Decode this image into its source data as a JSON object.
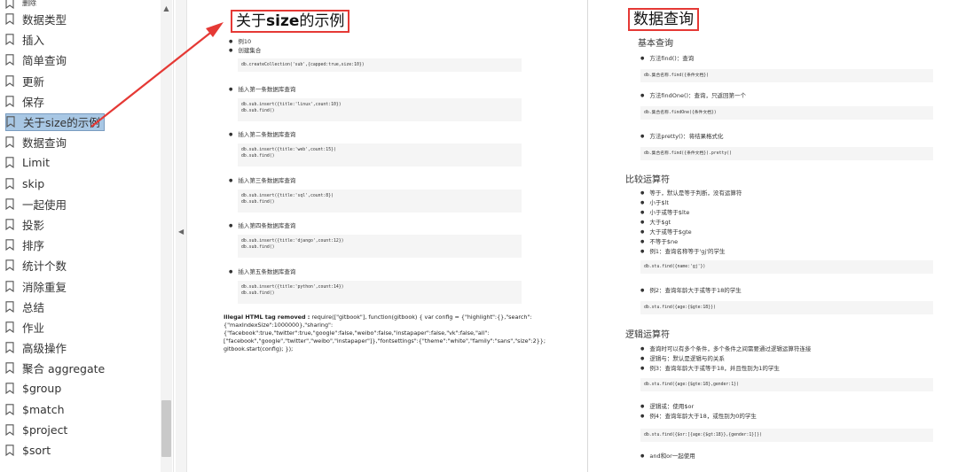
{
  "sidebar": {
    "items": [
      {
        "label": "删除"
      },
      {
        "label": "数据类型"
      },
      {
        "label": "插入"
      },
      {
        "label": "简单查询"
      },
      {
        "label": "更新"
      },
      {
        "label": "保存"
      },
      {
        "label": "关于size的示例"
      },
      {
        "label": "数据查询"
      },
      {
        "label": "Limit"
      },
      {
        "label": "skip"
      },
      {
        "label": "一起使用"
      },
      {
        "label": "投影"
      },
      {
        "label": "排序"
      },
      {
        "label": "统计个数"
      },
      {
        "label": "消除重复"
      },
      {
        "label": "总结"
      },
      {
        "label": "作业"
      },
      {
        "label": "高级操作"
      },
      {
        "label": "聚合 aggregate"
      },
      {
        "label": "$group"
      },
      {
        "label": "$match"
      },
      {
        "label": "$project"
      },
      {
        "label": "$sort"
      }
    ],
    "active_index": 6
  },
  "left_page": {
    "title_prefix": "关于",
    "title_bold": "size",
    "title_suffix": "的示例",
    "bullet1": "例10",
    "bullet2": "创建集合",
    "code1": "db.createCollection('sub',{capped:true,size:10})",
    "bullet3": "插入第一条数据库查询",
    "code2": "db.sub.insert({title:'linux',count:10})\ndb.sub.find()",
    "bullet4": "插入第二条数据库查询",
    "code3": "db.sub.insert({title:'web',count:15})\ndb.sub.find()",
    "bullet5": "插入第三条数据库查询",
    "code4": "db.sub.insert({title:'sql',count:8})\ndb.sub.find()",
    "bullet6": "插入第四条数据库查询",
    "code5": "db.sub.insert({title:'django',count:12})\ndb.sub.find()",
    "bullet7": "插入第五条数据库查询",
    "code6": "db.sub.insert({title:'python',count:14})\ndb.sub.find()",
    "para_bold": "Illegal HTML tag removed :",
    "para": " require([\"gitbook\"], function(gitbook) { var config = {\"highlight\":{},\"search\":\n{\"maxIndexSize\":1000000},\"sharing\":\n{\"facebook\":true,\"twitter\":true,\"google\":false,\"weibo\":false,\"instapaper\":false,\"vk\":false,\"all\":\n[\"facebook\",\"google\",\"twitter\",\"weibo\",\"instapaper\"]},\"fontsettings\":{\"theme\":\"white\",\"family\":\"sans\",\"size\":2}};\ngitbook.start(config); });"
  },
  "right_page": {
    "title": "数据查询",
    "h_basic": "基本查询",
    "b1": "方法find()：查询",
    "c1": "db.集合名称.find({条件文档})",
    "b2": "方法findOne()：查询，只返回第一个",
    "c2": "db.集合名称.findOne({条件文档})",
    "b3": "方法pretty()：将结果格式化",
    "c3": "db.集合名称.find({条件文档}).pretty()",
    "h_compare": "比较运算符",
    "cmp": [
      "等于，默认是等于判断，没有运算符",
      "小于$lt",
      "小于或等于$lte",
      "大于$gt",
      "大于或等于$gte",
      "不等于$ne",
      "例1：查询名称等于'gj'的学生"
    ],
    "c4": "db.stu.find({name:'gj'})",
    "b4": "例2：查询年龄大于或等于18的学生",
    "c5": "db.stu.find({age:{$gte:18}})",
    "h_logic": "逻辑运算符",
    "logic": [
      "查询时可以有多个条件，多个条件之间需要通过逻辑运算符连接",
      "逻辑与：默认是逻辑与的关系",
      "例3：查询年龄大于或等于18，并且性别为1的学生"
    ],
    "c6": "db.stu.find({age:{$gte:18},gender:1})",
    "logic2": [
      "逻辑或：使用$or",
      "例4：查询年龄大于18，或性别为0的学生"
    ],
    "c7": "db.stu.find({$or:[{age:{$gt:18}},{gender:1}]})",
    "b5": "and和or一起使用"
  },
  "colors": {
    "annotation": "#e53935",
    "active_bg": "#a8c7e4"
  }
}
